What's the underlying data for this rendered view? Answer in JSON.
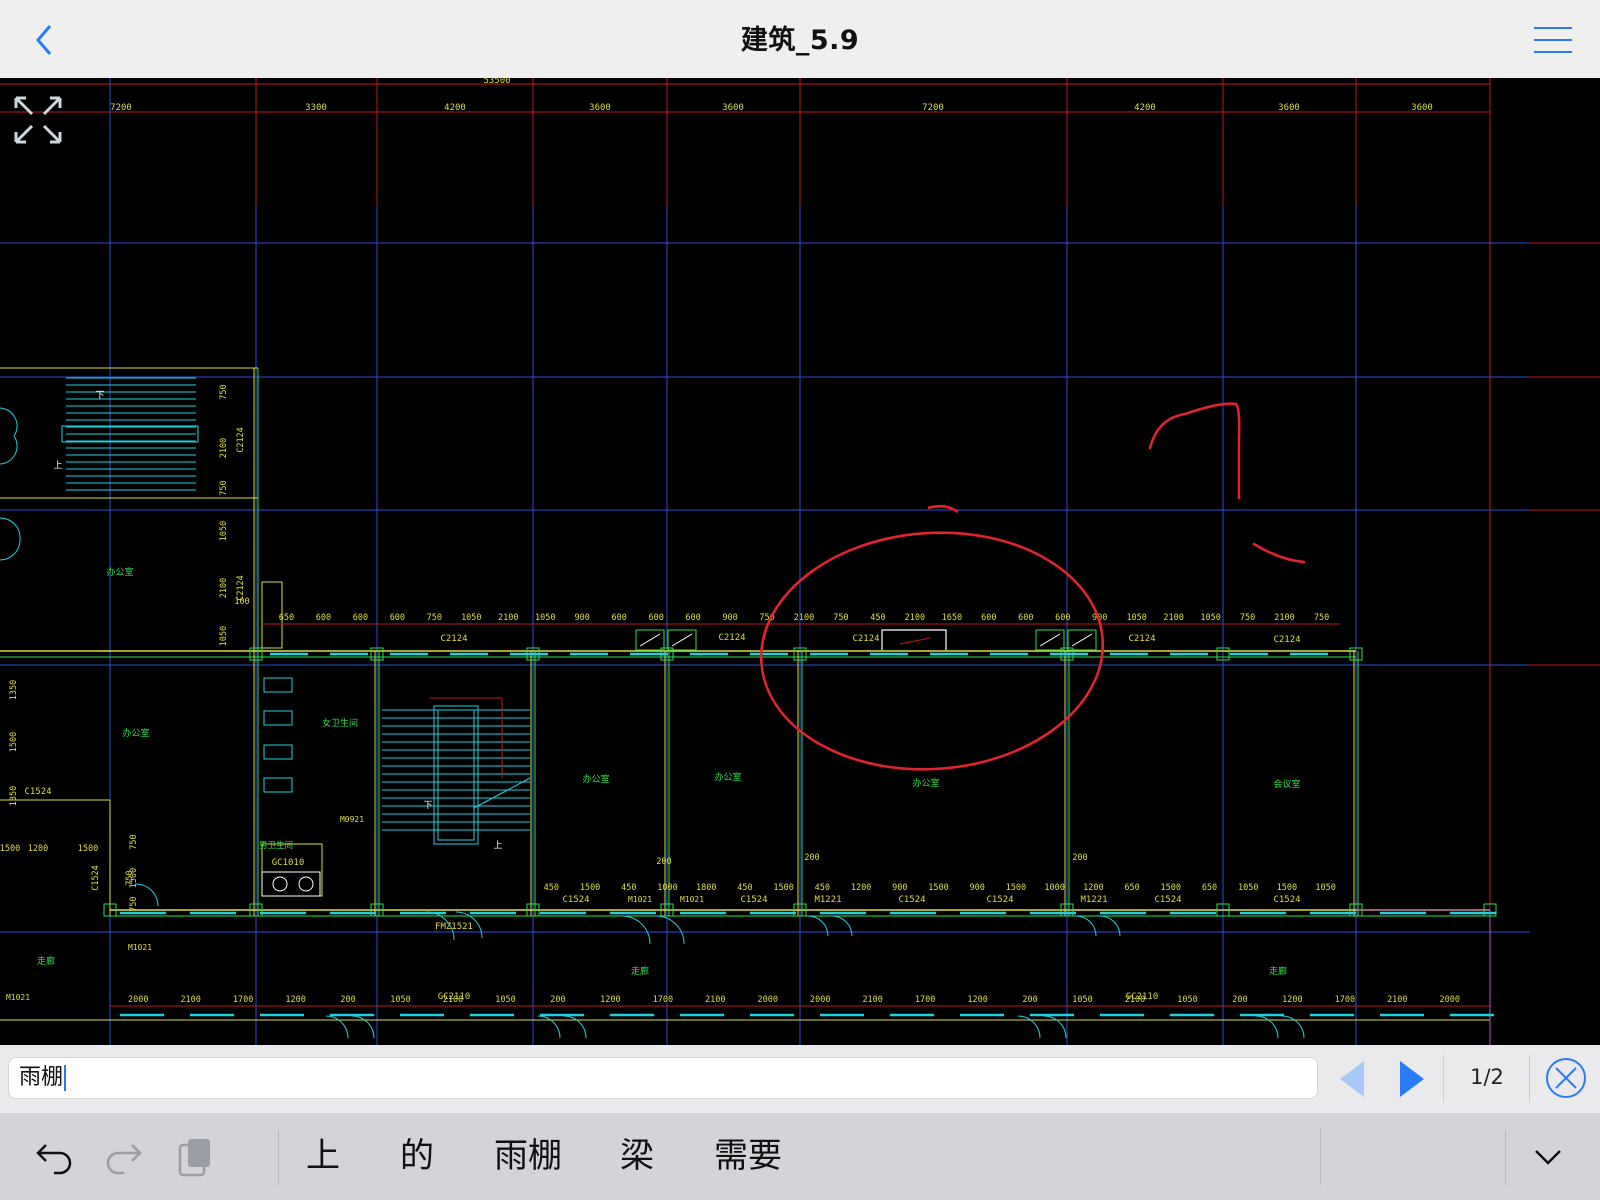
{
  "header": {
    "title": "建筑_5.9"
  },
  "search": {
    "query": "雨棚",
    "page_indicator": "1/2"
  },
  "keyboard": {
    "candidates": [
      "上",
      "的",
      "雨棚",
      "梁",
      "需要"
    ]
  },
  "drawing": {
    "top_total": "53500",
    "top_dims": [
      "7200",
      "3300",
      "4200",
      "3600",
      "3600",
      "7200",
      "4200",
      "3600",
      "3600"
    ],
    "row1_dims": [
      "650",
      "600",
      "600",
      "600",
      "750",
      "1050",
      "2100",
      "1050",
      "900",
      "600",
      "600",
      "600",
      "900",
      "750",
      "2100",
      "750",
      "450",
      "2100",
      "1650",
      "600",
      "600",
      "600",
      "900",
      "1050",
      "2100",
      "1050",
      "750",
      "2100",
      "750"
    ],
    "row2_dims": [
      "450",
      "1500",
      "450",
      "1000",
      "1800",
      "450",
      "1500",
      "450",
      "1200",
      "900",
      "1500",
      "900",
      "1500",
      "1000",
      "1200",
      "650",
      "1500",
      "650",
      "1050",
      "1500",
      "1050"
    ],
    "row3_dims": [
      "2000",
      "2100",
      "1700",
      "1200",
      "200",
      "1050",
      "2100",
      "1050",
      "200",
      "1200",
      "1700",
      "2100",
      "2000",
      "2000",
      "2100",
      "1700",
      "1200",
      "200",
      "1050",
      "2100",
      "1050",
      "200",
      "1200",
      "1700",
      "2100",
      "2000"
    ],
    "left_dims": [
      "1500",
      "1200",
      "1500",
      "750"
    ],
    "vert_dims": [
      "750",
      "2100",
      "750",
      "1050",
      "2100",
      "1050",
      "1350",
      "1500",
      "1350",
      "750",
      "1500",
      "750"
    ],
    "labels": {
      "window_c2124": "C2124",
      "window_c1524": "C1524",
      "door_m1021": "M1021",
      "door_m1221": "M1221",
      "door_m0921": "M0921",
      "door_fm": "FMZ1521",
      "gc2110": "GC2110",
      "gc1010": "GC1010",
      "office": "办公室",
      "meeting": "会议室",
      "corridor": "走廊",
      "toilet_m": "男卫生间",
      "toilet_f": "女卫生间",
      "up": "上",
      "down": "下",
      "v100": "100",
      "v200": "200"
    }
  },
  "colors": {
    "ink_red": "#e0242c",
    "cad_blue": "#2b4bd8",
    "cad_red": "#c01818",
    "cad_cyan": "#1fd0e0",
    "cad_green": "#2ee24a",
    "cad_yellow": "#dddd40",
    "accent": "#2a7cf6"
  }
}
